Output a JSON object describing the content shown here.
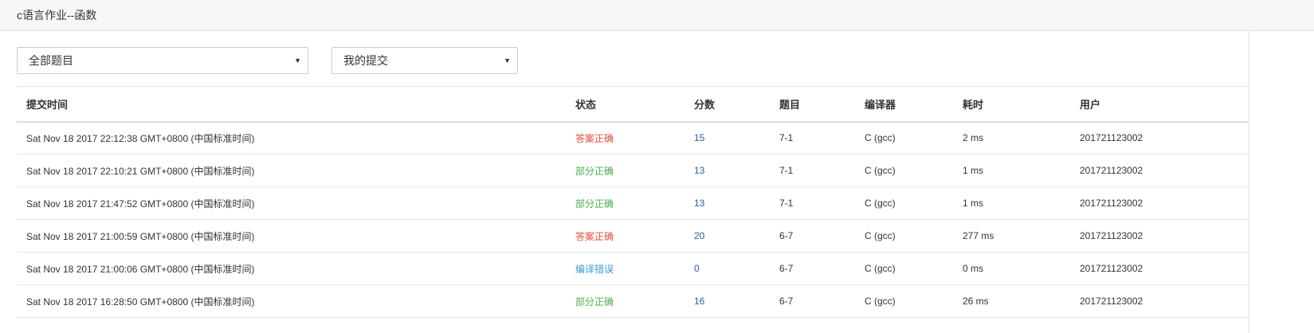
{
  "header": {
    "title": "c语言作业--函数"
  },
  "filters": {
    "problem_select": "全部题目",
    "submission_select": "我的提交"
  },
  "table": {
    "columns": [
      "提交时间",
      "状态",
      "分数",
      "题目",
      "编译器",
      "耗时",
      "用户"
    ],
    "rows": [
      {
        "time": "Sat Nov 18 2017 22:12:38 GMT+0800 (中国标准时间)",
        "status": "答案正确",
        "status_color": "#e74c3c",
        "score": "15",
        "problem": "7-1",
        "compiler": "C (gcc)",
        "elapsed": "2 ms",
        "user": "201721123002"
      },
      {
        "time": "Sat Nov 18 2017 22:10:21 GMT+0800 (中国标准时间)",
        "status": "部分正确",
        "status_color": "#4cae4c",
        "score": "13",
        "problem": "7-1",
        "compiler": "C (gcc)",
        "elapsed": "1 ms",
        "user": "201721123002"
      },
      {
        "time": "Sat Nov 18 2017 21:47:52 GMT+0800 (中国标准时间)",
        "status": "部分正确",
        "status_color": "#4cae4c",
        "score": "13",
        "problem": "7-1",
        "compiler": "C (gcc)",
        "elapsed": "1 ms",
        "user": "201721123002"
      },
      {
        "time": "Sat Nov 18 2017 21:00:59 GMT+0800 (中国标准时间)",
        "status": "答案正确",
        "status_color": "#e74c3c",
        "score": "20",
        "problem": "6-7",
        "compiler": "C (gcc)",
        "elapsed": "277 ms",
        "user": "201721123002"
      },
      {
        "time": "Sat Nov 18 2017 21:00:06 GMT+0800 (中国标准时间)",
        "status": "编译错误",
        "status_color": "#3a9ad9",
        "score": "0",
        "problem": "6-7",
        "compiler": "C (gcc)",
        "elapsed": "0 ms",
        "user": "201721123002"
      },
      {
        "time": "Sat Nov 18 2017 16:28:50 GMT+0800 (中国标准时间)",
        "status": "部分正确",
        "status_color": "#4cae4c",
        "score": "16",
        "problem": "6-7",
        "compiler": "C (gcc)",
        "elapsed": "26 ms",
        "user": "201721123002"
      }
    ]
  }
}
